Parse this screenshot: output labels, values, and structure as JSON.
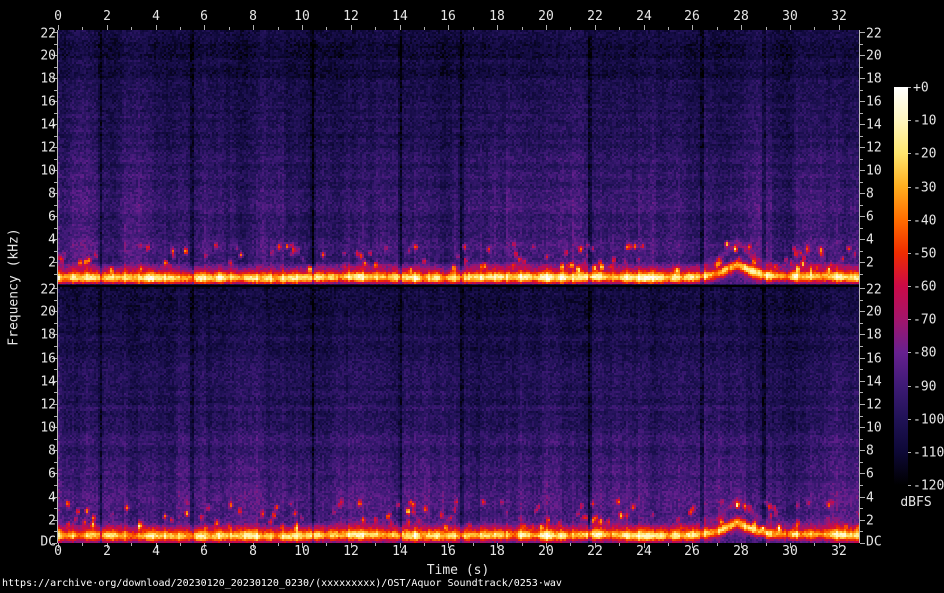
{
  "axes": {
    "time_label": "Time (s)",
    "freq_label": "Frequency (kHz)",
    "time_ticks": [
      "0",
      "2",
      "4",
      "6",
      "8",
      "10",
      "12",
      "14",
      "16",
      "18",
      "20",
      "22",
      "24",
      "26",
      "28",
      "30",
      "32"
    ],
    "freq_ticks": [
      "22",
      "20",
      "18",
      "16",
      "14",
      "12",
      "10",
      "8",
      "6",
      "4",
      "2"
    ],
    "dc_label": "DC"
  },
  "colorbar": {
    "label": "dBFS",
    "ticks": [
      "+0",
      "-10",
      "-20",
      "-30",
      "-40",
      "-50",
      "-60",
      "-70",
      "-80",
      "-90",
      "-100",
      "-110",
      "-120"
    ]
  },
  "footer": {
    "url": "https://archive·org/download/20230120_20230120_0230/(xxxxxxxxx)/OST/Aquor Soundtrack/0253·wav"
  },
  "chart_data": {
    "type": "heatmap",
    "subtype": "stereo-audio-spectrogram",
    "panels": [
      "channel-1 (top)",
      "channel-2 (bottom)"
    ],
    "x": {
      "label": "Time (s)",
      "range_s": [
        0,
        32.8
      ],
      "tick_step_s": 2
    },
    "y": {
      "label": "Frequency (kHz)",
      "range_khz": [
        0,
        22
      ],
      "tick_step_khz": 2,
      "bottom_tick": "DC"
    },
    "z": {
      "label": "dBFS",
      "range_db": [
        -120,
        0
      ],
      "tick_step_db": 10,
      "colorbar_position": "right"
    },
    "colormap_stops_db_hex": [
      [
        0,
        "#ffffff"
      ],
      [
        -10,
        "#fff6c0"
      ],
      [
        -20,
        "#ffe66e"
      ],
      [
        -30,
        "#ffae1f"
      ],
      [
        -40,
        "#ff6d00"
      ],
      [
        -50,
        "#ef2c00"
      ],
      [
        -60,
        "#cb0a47"
      ],
      [
        -70,
        "#a3156b"
      ],
      [
        -80,
        "#67208f"
      ],
      [
        -90,
        "#3e1a76"
      ],
      [
        -100,
        "#201256"
      ],
      [
        -110,
        "#0d0836"
      ],
      [
        -120,
        "#000000"
      ]
    ],
    "background_level_db": {
      "at_22khz": -108,
      "at_16khz": -103,
      "at_10khz": -96,
      "at_4khz": -90,
      "at_2khz": -88
    },
    "dominant_band": {
      "description": "Bright fundamental band near 0.5-1.3 kHz across the whole file, rising to ~2 kHz around t=27.8 s, identical in both channels",
      "times_s": [
        0,
        4,
        8,
        12,
        16,
        20,
        24,
        26,
        27,
        27.8,
        28.4,
        29,
        30,
        32.8
      ],
      "center_khz": [
        0.7,
        0.72,
        0.68,
        0.75,
        0.7,
        0.78,
        0.72,
        0.8,
        1.1,
        1.9,
        1.3,
        0.9,
        0.8,
        0.75
      ],
      "peak_level_db": -12,
      "bandwidth_khz": 0.7
    },
    "quiet_gap_times_s": [
      1.7,
      5.45,
      10.4,
      14.0,
      16.5,
      21.75,
      26.35,
      28.9
    ],
    "onset_period_s": 0.54,
    "grid": false,
    "legend": false
  }
}
